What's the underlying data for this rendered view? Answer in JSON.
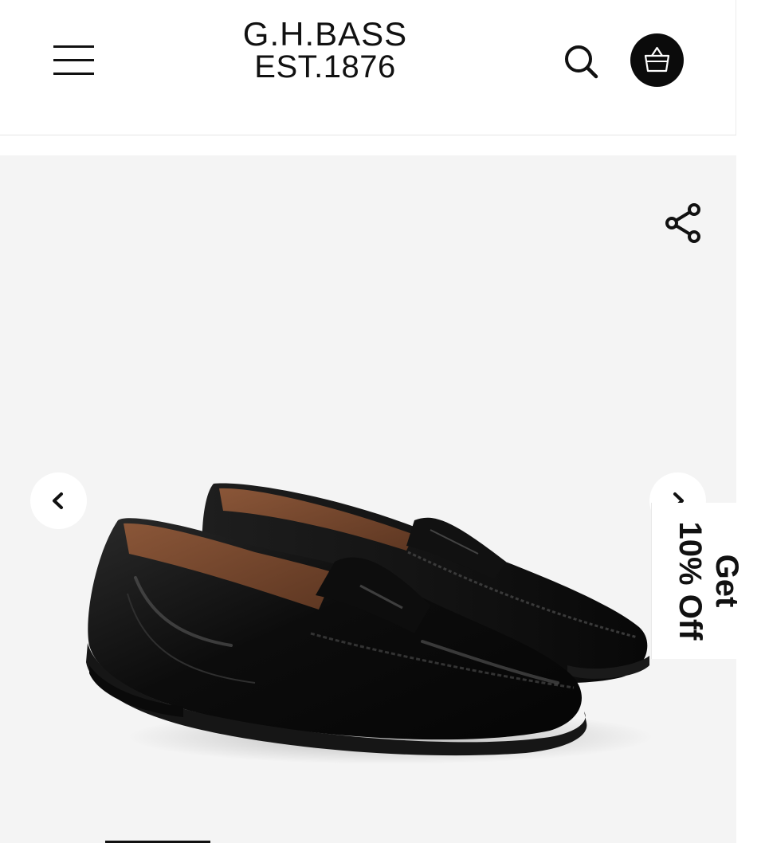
{
  "header": {
    "menu_icon": "hamburger-menu-icon",
    "logo_line1": "G.H.BASS",
    "logo_line2": "EST.1876",
    "search_icon": "search-icon",
    "cart_icon": "basket-icon",
    "cart_bg": "#0b0b0b"
  },
  "gallery": {
    "background": "#f4f4f4",
    "share_icon": "share-icon",
    "prev_icon": "chevron-left-icon",
    "next_icon": "chevron-right-icon",
    "image": "black-penny-loafers-image"
  },
  "promo": {
    "line1": "Get",
    "line2": "10% Off"
  }
}
